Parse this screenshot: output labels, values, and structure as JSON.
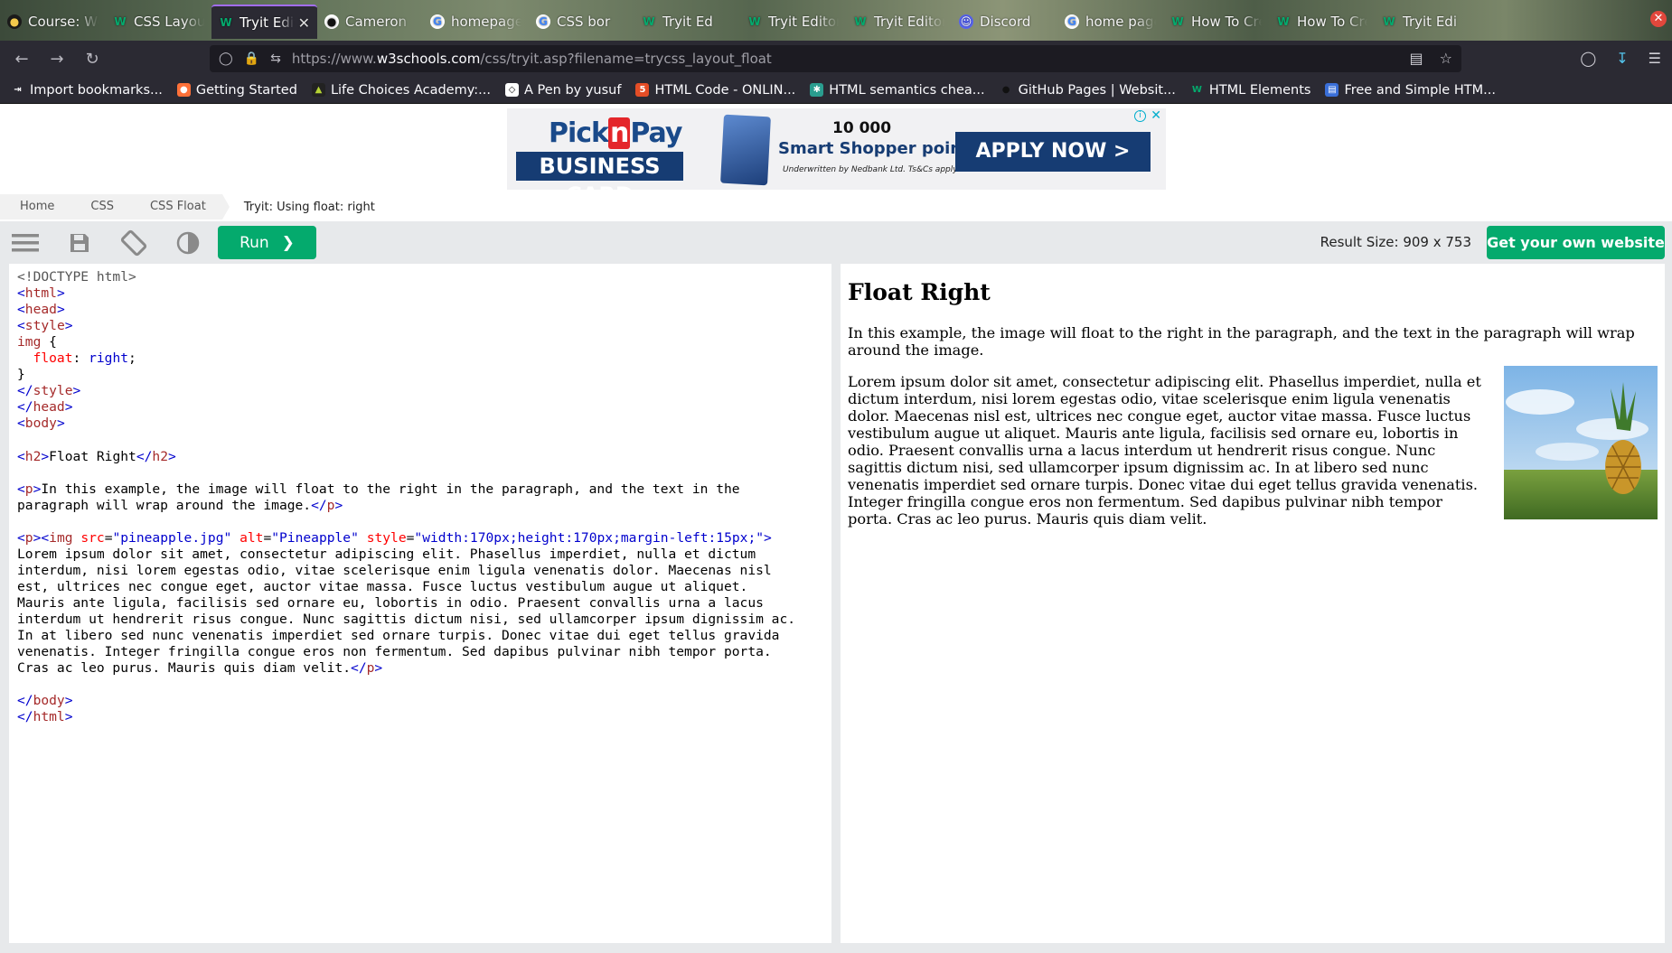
{
  "browser": {
    "tabs": [
      {
        "label": "Course: Web",
        "icon": "course-icon",
        "active": false
      },
      {
        "label": "CSS Layout",
        "icon": "w3schools-icon",
        "active": false
      },
      {
        "label": "Tryit Edit",
        "icon": "w3schools-icon",
        "active": true
      },
      {
        "label": "Cameron",
        "icon": "github-icon",
        "active": false
      },
      {
        "label": "homepage",
        "icon": "google-icon",
        "active": false
      },
      {
        "label": "CSS bor",
        "icon": "google-icon",
        "active": false
      },
      {
        "label": "Tryit Ed",
        "icon": "w3schools-icon",
        "active": false
      },
      {
        "label": "Tryit Editor",
        "icon": "w3schools-icon",
        "active": false
      },
      {
        "label": "Tryit Editor",
        "icon": "w3schools-icon",
        "active": false
      },
      {
        "label": "Discord",
        "icon": "discord-icon",
        "active": false
      },
      {
        "label": "home page",
        "icon": "google-icon",
        "active": false
      },
      {
        "label": "How To Cre",
        "icon": "w3schools-icon",
        "active": false
      },
      {
        "label": "How To Cre",
        "icon": "w3schools-icon",
        "active": false
      },
      {
        "label": "Tryit Edi",
        "icon": "w3schools-icon",
        "active": false
      }
    ],
    "url_prefix": "https://www.",
    "url_domain": "w3schools.com",
    "url_path": "/css/tryit.asp?filename=trycss_layout_float",
    "bookmarks": [
      {
        "label": "Import bookmarks...",
        "icon": "import-icon"
      },
      {
        "label": "Getting Started",
        "icon": "firefox-icon"
      },
      {
        "label": "Life Choices Academy:...",
        "icon": "lca-icon"
      },
      {
        "label": "A Pen by yusuf",
        "icon": "codepen-icon"
      },
      {
        "label": "HTML Code - ONLIN...",
        "icon": "html-icon"
      },
      {
        "label": "HTML semantics chea...",
        "icon": "cheatsheet-icon"
      },
      {
        "label": "GitHub Pages | Websit...",
        "icon": "github-icon"
      },
      {
        "label": "HTML Elements",
        "icon": "w3schools-icon"
      },
      {
        "label": "Free and Simple HTM...",
        "icon": "template-icon"
      }
    ]
  },
  "ad": {
    "brand": "Pick n Pay",
    "product": "BUSINESS CARD",
    "points_line1": "10 000",
    "points_line2": "Smart Shopper points.",
    "fine_print": "Underwritten by Nedbank Ltd. Ts&Cs apply.",
    "cta": "APPLY NOW >"
  },
  "breadcrumb": [
    "Home",
    "CSS",
    "CSS Float"
  ],
  "breadcrumb_current": "Tryit: Using float: right",
  "toolbar": {
    "run_label": "Run",
    "result_size": "Result Size: 909 x 753",
    "get_website_label": "Get your own website"
  },
  "code_lines": [
    [
      {
        "c": "doc",
        "t": "<!DOCTYPE html>"
      }
    ],
    [
      {
        "c": "br",
        "t": "<"
      },
      {
        "c": "tag",
        "t": "html"
      },
      {
        "c": "br",
        "t": ">"
      }
    ],
    [
      {
        "c": "br",
        "t": "<"
      },
      {
        "c": "tag",
        "t": "head"
      },
      {
        "c": "br",
        "t": ">"
      }
    ],
    [
      {
        "c": "br",
        "t": "<"
      },
      {
        "c": "tag",
        "t": "style"
      },
      {
        "c": "br",
        "t": ">"
      }
    ],
    [
      {
        "c": "tag",
        "t": "img"
      },
      {
        "c": "",
        "t": " {"
      }
    ],
    [
      {
        "c": "",
        "t": "  "
      },
      {
        "c": "prop",
        "t": "float"
      },
      {
        "c": "",
        "t": ": "
      },
      {
        "c": "pval",
        "t": "right"
      },
      {
        "c": "",
        "t": ";"
      }
    ],
    [
      {
        "c": "",
        "t": "}"
      }
    ],
    [
      {
        "c": "br",
        "t": "</"
      },
      {
        "c": "tag",
        "t": "style"
      },
      {
        "c": "br",
        "t": ">"
      }
    ],
    [
      {
        "c": "br",
        "t": "</"
      },
      {
        "c": "tag",
        "t": "head"
      },
      {
        "c": "br",
        "t": ">"
      }
    ],
    [
      {
        "c": "br",
        "t": "<"
      },
      {
        "c": "tag",
        "t": "body"
      },
      {
        "c": "br",
        "t": ">"
      }
    ],
    [
      {
        "c": "",
        "t": ""
      }
    ],
    [
      {
        "c": "br",
        "t": "<"
      },
      {
        "c": "tag",
        "t": "h2"
      },
      {
        "c": "br",
        "t": ">"
      },
      {
        "c": "",
        "t": "Float Right"
      },
      {
        "c": "br",
        "t": "</"
      },
      {
        "c": "tag",
        "t": "h2"
      },
      {
        "c": "br",
        "t": ">"
      }
    ],
    [
      {
        "c": "",
        "t": ""
      }
    ],
    [
      {
        "c": "br",
        "t": "<"
      },
      {
        "c": "tag",
        "t": "p"
      },
      {
        "c": "br",
        "t": ">"
      },
      {
        "c": "",
        "t": "In this example, the image will float to the right in the paragraph, and the text in the"
      }
    ],
    [
      {
        "c": "",
        "t": "paragraph will wrap around the image."
      },
      {
        "c": "br",
        "t": "</"
      },
      {
        "c": "tag",
        "t": "p"
      },
      {
        "c": "br",
        "t": ">"
      }
    ],
    [
      {
        "c": "",
        "t": ""
      }
    ],
    [
      {
        "c": "br",
        "t": "<"
      },
      {
        "c": "tag",
        "t": "p"
      },
      {
        "c": "br",
        "t": "><"
      },
      {
        "c": "tag",
        "t": "img"
      },
      {
        "c": "",
        "t": " "
      },
      {
        "c": "attr",
        "t": "src"
      },
      {
        "c": "",
        "t": "="
      },
      {
        "c": "val",
        "t": "\"pineapple.jpg\""
      },
      {
        "c": "",
        "t": " "
      },
      {
        "c": "attr",
        "t": "alt"
      },
      {
        "c": "",
        "t": "="
      },
      {
        "c": "val",
        "t": "\"Pineapple\""
      },
      {
        "c": "",
        "t": " "
      },
      {
        "c": "attr",
        "t": "style"
      },
      {
        "c": "",
        "t": "="
      },
      {
        "c": "val",
        "t": "\"width:170px;height:170px;margin-left:15px;\""
      },
      {
        "c": "br",
        "t": ">"
      }
    ],
    [
      {
        "c": "",
        "t": "Lorem ipsum dolor sit amet, consectetur adipiscing elit. Phasellus imperdiet, nulla et dictum"
      }
    ],
    [
      {
        "c": "",
        "t": "interdum, nisi lorem egestas odio, vitae scelerisque enim ligula venenatis dolor. Maecenas nisl"
      }
    ],
    [
      {
        "c": "",
        "t": "est, ultrices nec congue eget, auctor vitae massa. Fusce luctus vestibulum augue ut aliquet."
      }
    ],
    [
      {
        "c": "",
        "t": "Mauris ante ligula, facilisis sed ornare eu, lobortis in odio. Praesent convallis urna a lacus"
      }
    ],
    [
      {
        "c": "",
        "t": "interdum ut hendrerit risus congue. Nunc sagittis dictum nisi, sed ullamcorper ipsum dignissim ac."
      }
    ],
    [
      {
        "c": "",
        "t": "In at libero sed nunc venenatis imperdiet sed ornare turpis. Donec vitae dui eget tellus gravida"
      }
    ],
    [
      {
        "c": "",
        "t": "venenatis. Integer fringilla congue eros non fermentum. Sed dapibus pulvinar nibh tempor porta."
      }
    ],
    [
      {
        "c": "",
        "t": "Cras ac leo purus. Mauris quis diam velit."
      },
      {
        "c": "br",
        "t": "</"
      },
      {
        "c": "tag",
        "t": "p"
      },
      {
        "c": "br",
        "t": ">"
      }
    ],
    [
      {
        "c": "",
        "t": ""
      }
    ],
    [
      {
        "c": "br",
        "t": "</"
      },
      {
        "c": "tag",
        "t": "body"
      },
      {
        "c": "br",
        "t": ">"
      }
    ],
    [
      {
        "c": "br",
        "t": "</"
      },
      {
        "c": "tag",
        "t": "html"
      },
      {
        "c": "br",
        "t": ">"
      }
    ]
  ],
  "result": {
    "title": "Float Right",
    "intro": "In this example, the image will float to the right in the paragraph, and the text in the paragraph will wrap around the image.",
    "image_alt": "Pineapple",
    "body": "Lorem ipsum dolor sit amet, consectetur adipiscing elit. Phasellus imperdiet, nulla et dictum interdum, nisi lorem egestas odio, vitae scelerisque enim ligula venenatis dolor. Maecenas nisl est, ultrices nec congue eget, auctor vitae massa. Fusce luctus vestibulum augue ut aliquet. Mauris ante ligula, facilisis sed ornare eu, lobortis in odio. Praesent convallis urna a lacus interdum ut hendrerit risus congue. Nunc sagittis dictum nisi, sed ullamcorper ipsum dignissim ac. In at libero sed nunc venenatis imperdiet sed ornare turpis. Donec vitae dui eget tellus gravida venenatis. Integer fringilla congue eros non fermentum. Sed dapibus pulvinar nibh tempor porta. Cras ac leo purus. Mauris quis diam velit."
  },
  "colors": {
    "accent_green": "#04aa6d",
    "toolbar_bg": "#e7e9eb",
    "browser_chrome": "#2b2a33"
  }
}
